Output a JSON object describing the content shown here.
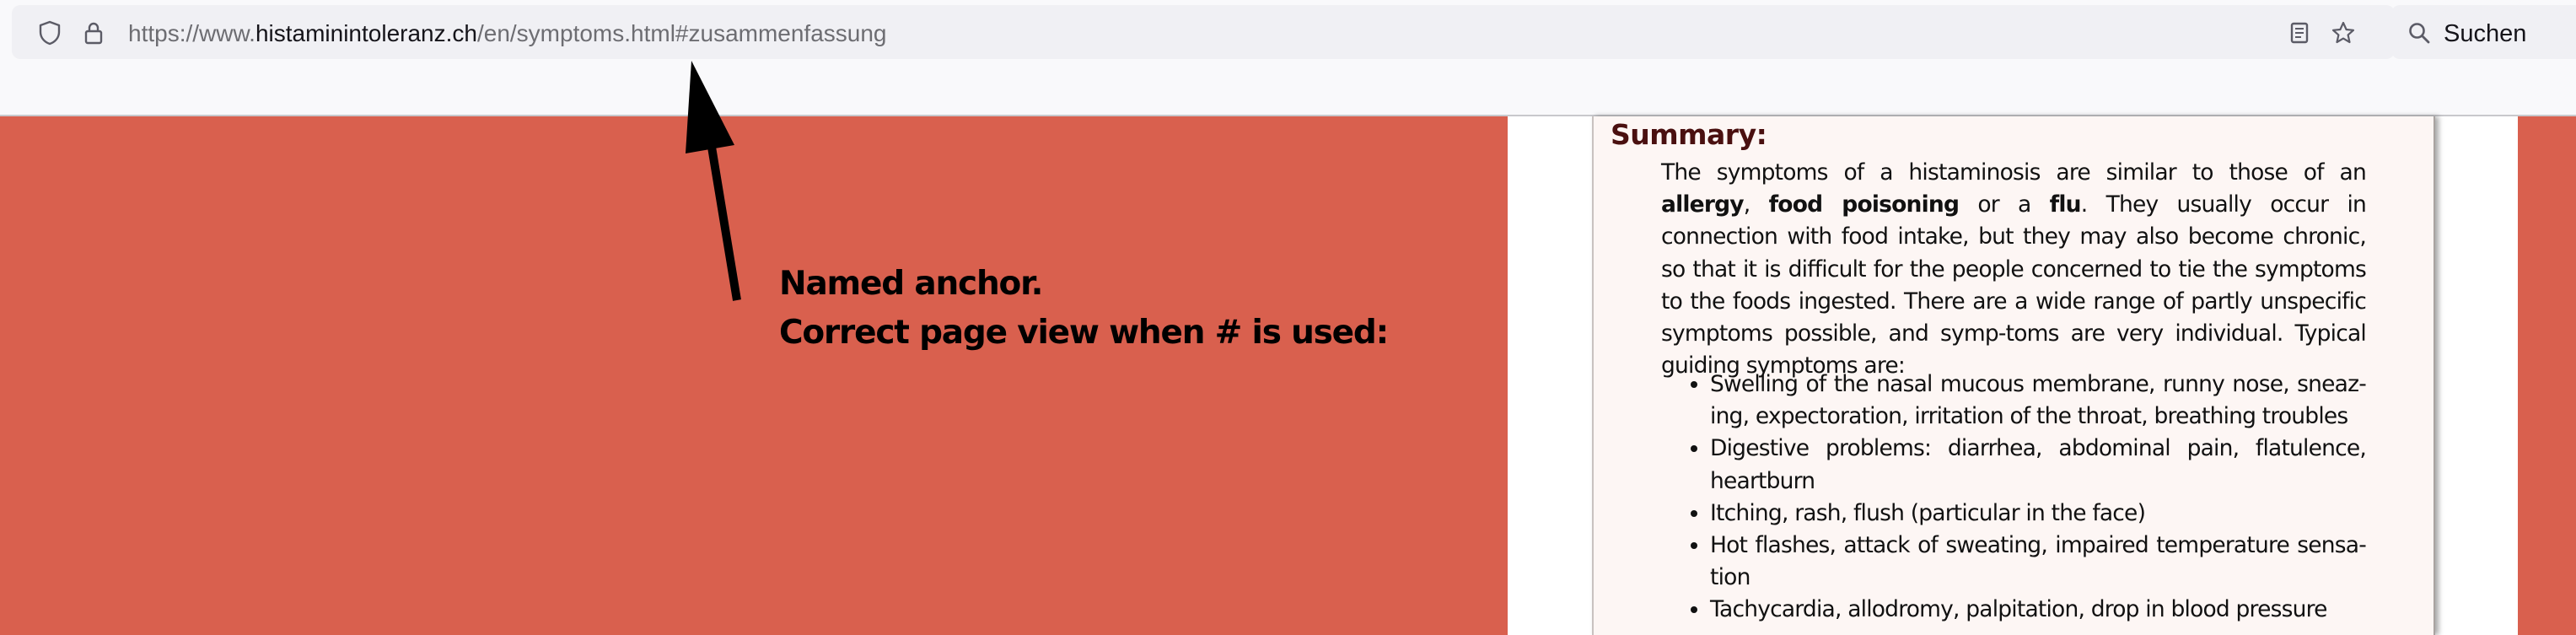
{
  "browser": {
    "url_prefix": "https://www.",
    "url_host": "histaminintoleranz.ch",
    "url_path": "/en/symptoms.html#zusammenfassung",
    "search_label": "Suchen",
    "icons": [
      "shield-icon",
      "lock-icon",
      "reader-view-icon",
      "bookmark-star-icon",
      "search-icon"
    ]
  },
  "colors": {
    "page_background": "#d9604e",
    "sheet_background": "#fdf6f4",
    "heading": "#4a1010"
  },
  "content": {
    "heading": "Summary:",
    "intro": {
      "t1": "The symptoms of a histaminosis are similar to those of an ",
      "b1": "allergy",
      "t2": ", ",
      "b2": "food poisoning",
      "t3": " or a ",
      "b3": "flu",
      "t4": ". They usually occur in connection with food intake, but they may also become chronic, so that it is difficult for the people concerned to tie the symptoms to the foods ingested. There are a wide range of partly unspecific symptoms possible, and symp-toms are very individual. Typical guiding symptoms are:"
    },
    "symptoms": [
      "Swelling of the nasal mucous membrane, runny nose, sneaz-ing, expectoration, irritation of the throat, breathing troubles",
      "Digestive problems: diarrhea, abdominal pain, flatulence, heartburn",
      "Itching, rash, flush (particular in the face)",
      "Hot flashes, attack of sweating, impaired temperature sensa-tion",
      "Tachycardia, allodromy, palpitation, drop in blood pressure"
    ]
  },
  "annotation": {
    "line1": "Named anchor.",
    "line2": "Correct page view when # is used:"
  }
}
